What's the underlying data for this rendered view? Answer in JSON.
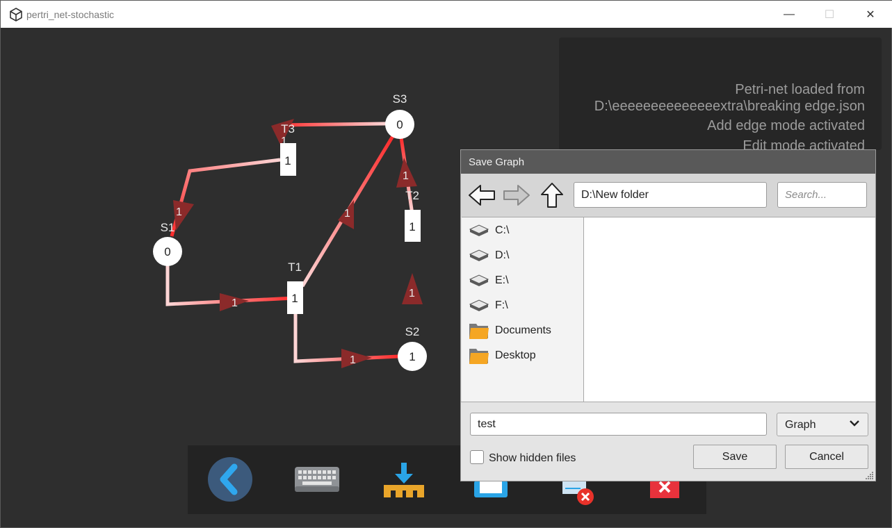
{
  "window": {
    "title": "pertri_net-stochastic",
    "controls": {
      "minimize": "—",
      "maximize": "☐",
      "close": "✕"
    }
  },
  "graph": {
    "places": [
      {
        "name": "S1",
        "tokens": "0"
      },
      {
        "name": "S2",
        "tokens": "1"
      },
      {
        "name": "S3",
        "tokens": "0"
      }
    ],
    "transitions": [
      {
        "name": "T1",
        "value": "1"
      },
      {
        "name": "T2",
        "value": "1"
      },
      {
        "name": "T3",
        "value": "1"
      }
    ],
    "arcs": [
      {
        "from": "S1",
        "to": "T1",
        "weight": "1"
      },
      {
        "from": "T1",
        "to": "S2",
        "weight": "1"
      },
      {
        "from": "T1",
        "to": "S3",
        "weight": "1"
      },
      {
        "from": "S2",
        "to": "T2",
        "weight": "1"
      },
      {
        "from": "T2",
        "to": "S3",
        "weight": "1"
      },
      {
        "from": "S3",
        "to": "T3",
        "weight": "1"
      },
      {
        "from": "T3",
        "to": "S1",
        "weight": "1"
      }
    ],
    "colors": {
      "arc_strong": "#ff2b2b",
      "arc_light": "#ffd6d6",
      "arrow": "#8b2a2a",
      "node_fill": "#ffffff"
    }
  },
  "log": {
    "lines": [
      "Petri-net loaded from",
      "D:\\eeeeeeeeeeeeeextra\\breaking edge.json",
      "Add edge mode activated",
      "Edit mode activated"
    ]
  },
  "toolbar": {
    "items": [
      {
        "name": "back-icon"
      },
      {
        "name": "keyboard-icon"
      },
      {
        "name": "import-icon"
      },
      {
        "name": "save-icon"
      },
      {
        "name": "clear-edges-icon"
      },
      {
        "name": "exit-icon"
      }
    ]
  },
  "dialog": {
    "title": "Save Graph",
    "path": "D:\\New folder",
    "search_placeholder": "Search...",
    "quick_links": [
      {
        "label": "C:\\",
        "icon": "drive-icon"
      },
      {
        "label": "D:\\",
        "icon": "drive-icon"
      },
      {
        "label": "E:\\",
        "icon": "drive-icon"
      },
      {
        "label": "F:\\",
        "icon": "drive-icon"
      },
      {
        "label": "Documents",
        "icon": "folder-icon"
      },
      {
        "label": "Desktop",
        "icon": "folder-icon"
      }
    ],
    "filename": "test",
    "filter": "Graph",
    "show_hidden_label": "Show hidden files",
    "show_hidden_checked": false,
    "save_label": "Save",
    "cancel_label": "Cancel"
  }
}
